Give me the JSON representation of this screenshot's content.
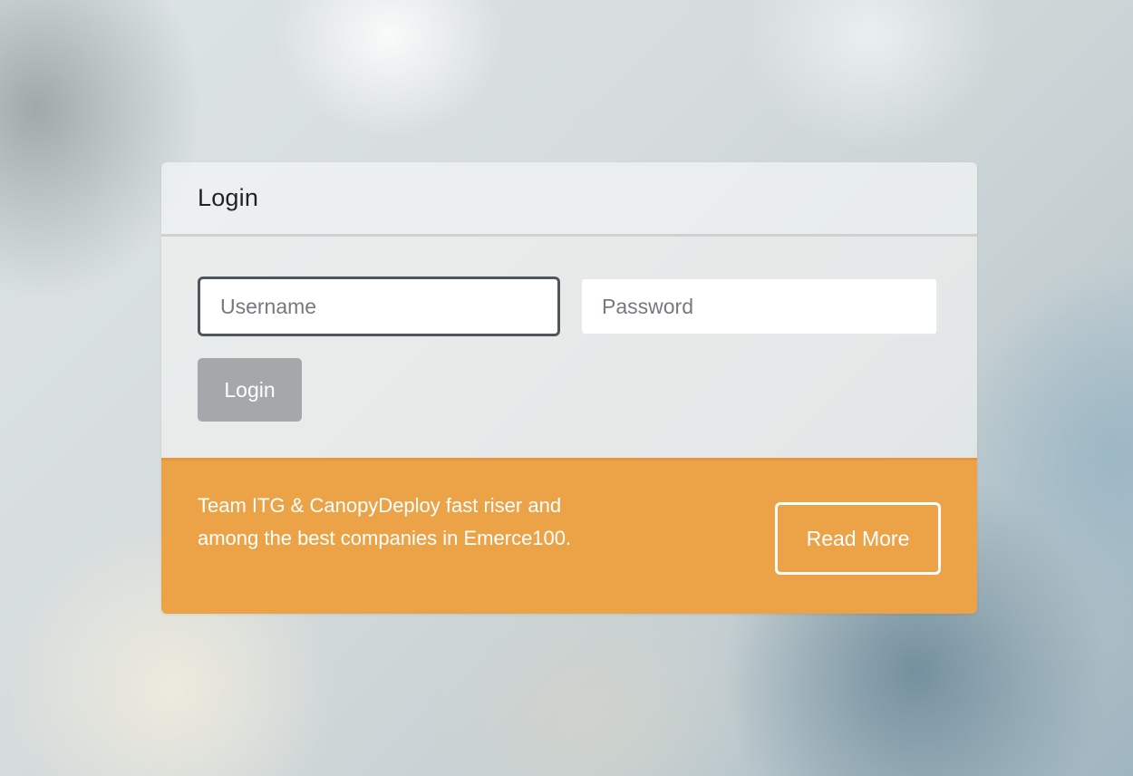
{
  "login": {
    "title": "Login",
    "username_placeholder": "Username",
    "password_placeholder": "Password",
    "submit_label": "Login"
  },
  "banner": {
    "text": "Team ITG & CanopyDeploy fast riser and among the best companies in Emerce100.",
    "button_label": "Read More"
  },
  "colors": {
    "banner": "#eca348",
    "button_disabled": "#a5a8aa",
    "focus_border": "#50575c"
  }
}
